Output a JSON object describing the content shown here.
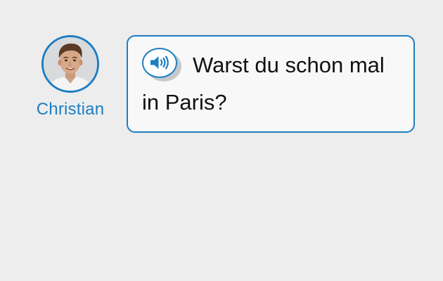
{
  "speaker": {
    "name": "Christian"
  },
  "message": {
    "text": "Warst du schon mal in Paris?"
  },
  "colors": {
    "accent": "#1c7ec2",
    "background": "#ededed",
    "bubble": "#f8f8f8",
    "text": "#111111"
  },
  "icons": {
    "audio": "speaker-volume-icon"
  }
}
